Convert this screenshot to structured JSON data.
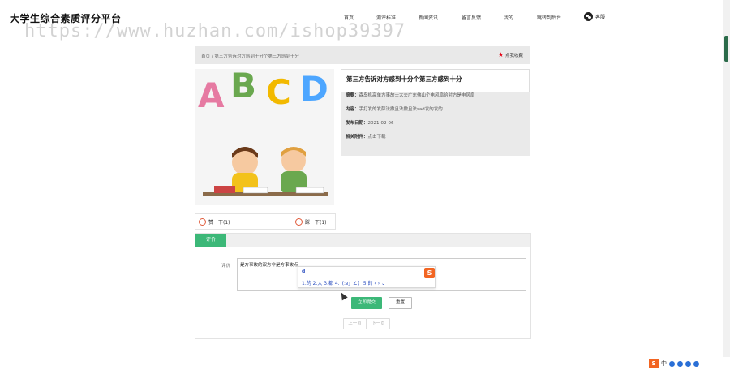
{
  "site": {
    "title": "大学生综合素质评分平台",
    "watermark": "https://www.huzhan.com/ishop39397"
  },
  "nav": {
    "items": [
      "首页",
      "测评标准",
      "新闻资讯",
      "留言反馈",
      "我的",
      "跳转到后台"
    ],
    "wechat_label": "客服"
  },
  "breadcrumb": {
    "path": "首页 / 第三方告诉对方感到十分个第三方感到十分",
    "favorite": "点我收藏"
  },
  "article": {
    "title": "第三方告诉对方感到十分个第三方感到十分",
    "summary_label": "摘要：",
    "summary": "森岛机高单方事故士大夫广东佛山个电风扇给对方是电风扇",
    "content_label": "内容：",
    "content": "手打发的发萨法撒旦法撒旦法sad发的发的",
    "date_label": "发布日期：",
    "date": "2021-02-06",
    "attachment_label": "相关附件：",
    "attachment": "点击下载",
    "image_letters": [
      "A",
      "B",
      "C",
      "D"
    ]
  },
  "votes": {
    "up": "赞一下(1)",
    "down": "踩一下(1)"
  },
  "comment": {
    "tab": "评价",
    "label": "评价",
    "value": "是方事故的双方非是方事故点",
    "submit": "立即提交",
    "reset": "重置",
    "prev": "上一页",
    "next": "下一页"
  },
  "ime": {
    "typed": "d",
    "candidates": "1.的  2.大  3.都  4._(:з」∠)_  5.的  ‹ › ⌄"
  },
  "tray": {
    "label": "中"
  },
  "colors": {
    "accent": "#3cb878",
    "star": "#e60012",
    "ime": "#2a4dbf"
  }
}
